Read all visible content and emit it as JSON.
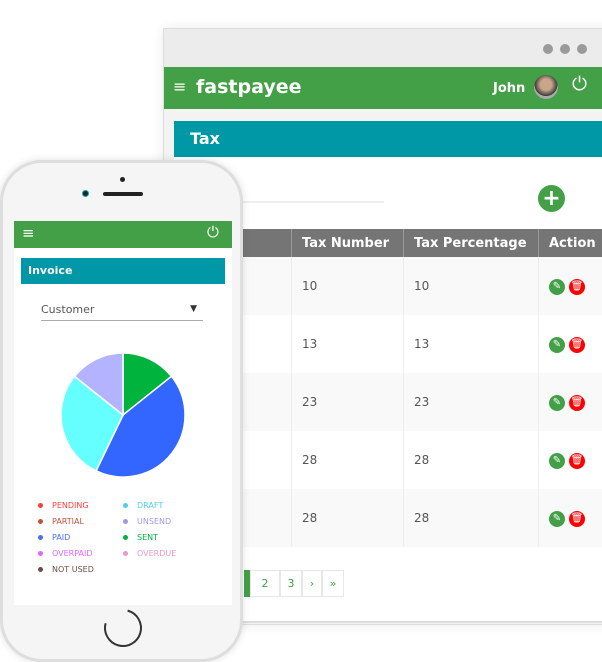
{
  "browser": {
    "brand": "fastpayee",
    "user": "John",
    "page_title": "Tax",
    "table": {
      "headers": [
        "",
        "Tax Number",
        "Tax Percentage",
        "Action"
      ],
      "rows": [
        [
          "10",
          "10"
        ],
        [
          "13",
          "13"
        ],
        [
          "23",
          "23"
        ],
        [
          "28",
          "28"
        ],
        [
          "28",
          "28"
        ]
      ]
    },
    "pagination": [
      "2",
      "3",
      "›",
      "»"
    ]
  },
  "phone": {
    "page_title": "Invoice",
    "select_value": "Customer",
    "legend": [
      {
        "label": "PENDING",
        "color": "#f44336"
      },
      {
        "label": "DRAFT",
        "color": "#4dd0e1"
      },
      {
        "label": "PARTIAL",
        "color": "#c0533a"
      },
      {
        "label": "UNSEND",
        "color": "#9e9be0"
      },
      {
        "label": "PAID",
        "color": "#4a6cf7"
      },
      {
        "label": "SENT",
        "color": "#00b33c"
      },
      {
        "label": "OVERPAID",
        "color": "#e066ff"
      },
      {
        "label": "OVERDUE",
        "color": "#e89ac7"
      },
      {
        "label": "NOT USED",
        "color": "#6d4c41"
      }
    ]
  },
  "chart_data": {
    "type": "pie",
    "slices": [
      {
        "label": "SENT",
        "value": 1,
        "color": "#00b33c"
      },
      {
        "label": "PAID",
        "value": 3,
        "color": "#3366ff"
      },
      {
        "label": "DRAFT",
        "value": 2,
        "color": "#66ffff"
      },
      {
        "label": "UNSEND",
        "value": 1,
        "color": "#b3b3ff"
      }
    ]
  },
  "colors": {
    "green": "#43a047",
    "teal": "#0097a7",
    "header_gray": "#757575",
    "delete": "#ff0000"
  }
}
